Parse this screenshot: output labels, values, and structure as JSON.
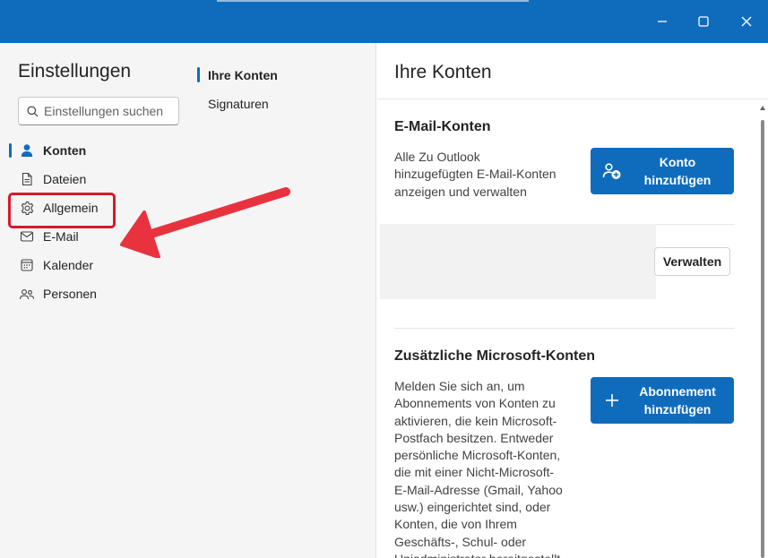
{
  "window": {
    "minimize_icon": "minimize-icon",
    "maximize_icon": "maximize-icon",
    "close_icon": "close-icon",
    "titlebar_color": "#0f6cbd"
  },
  "sidebar": {
    "title": "Einstellungen",
    "search": {
      "placeholder": "Einstellungen suchen",
      "value": ""
    },
    "items": [
      {
        "label": "Konten",
        "icon": "person-icon",
        "selected": true
      },
      {
        "label": "Dateien",
        "icon": "document-icon",
        "selected": false
      },
      {
        "label": "Allgemein",
        "icon": "gear-icon",
        "selected": false,
        "highlighted": true
      },
      {
        "label": "E-Mail",
        "icon": "mail-icon",
        "selected": false
      },
      {
        "label": "Kalender",
        "icon": "calendar-icon",
        "selected": false
      },
      {
        "label": "Personen",
        "icon": "people-icon",
        "selected": false
      }
    ]
  },
  "subnav": {
    "items": [
      {
        "label": "Ihre Konten",
        "selected": true
      },
      {
        "label": "Signaturen",
        "selected": false
      }
    ]
  },
  "annotation": {
    "arrow_color": "#e8333f",
    "highlight_color": "#d71a2a"
  },
  "main": {
    "title": "Ihre Konten",
    "email_accounts": {
      "title": "E-Mail-Konten",
      "description_lines": [
        "Alle Zu Outlook",
        "hinzugefügten E-Mail-Konten",
        "anzeigen und verwalten"
      ],
      "add_button_lines": [
        "Konto",
        "hinzufügen"
      ],
      "add_button_icon": "add-person-icon",
      "manage_button": "Verwalten"
    },
    "additional_accounts": {
      "title": "Zusätzliche Microsoft-Konten",
      "description_lines": [
        "Melden Sie sich an, um",
        "Abonnements von Konten zu",
        "aktivieren, die kein Microsoft-",
        "Postfach besitzen. Entweder",
        "persönliche Microsoft-Konten,",
        "die mit einer Nicht-Microsoft-",
        "E-Mail-Adresse (Gmail, Yahoo",
        "usw.) eingerichtet sind, oder",
        "Konten, die von Ihrem",
        "Geschäfts-, Schul- oder",
        "Uniadministrator bereitgestellt"
      ],
      "subscribe_button_lines": [
        "Abonnement",
        "hinzufügen"
      ],
      "subscribe_button_icon": "plus-icon"
    }
  },
  "colors": {
    "accent": "#0f6cbd",
    "pane_bg": "#f5f5f5"
  }
}
